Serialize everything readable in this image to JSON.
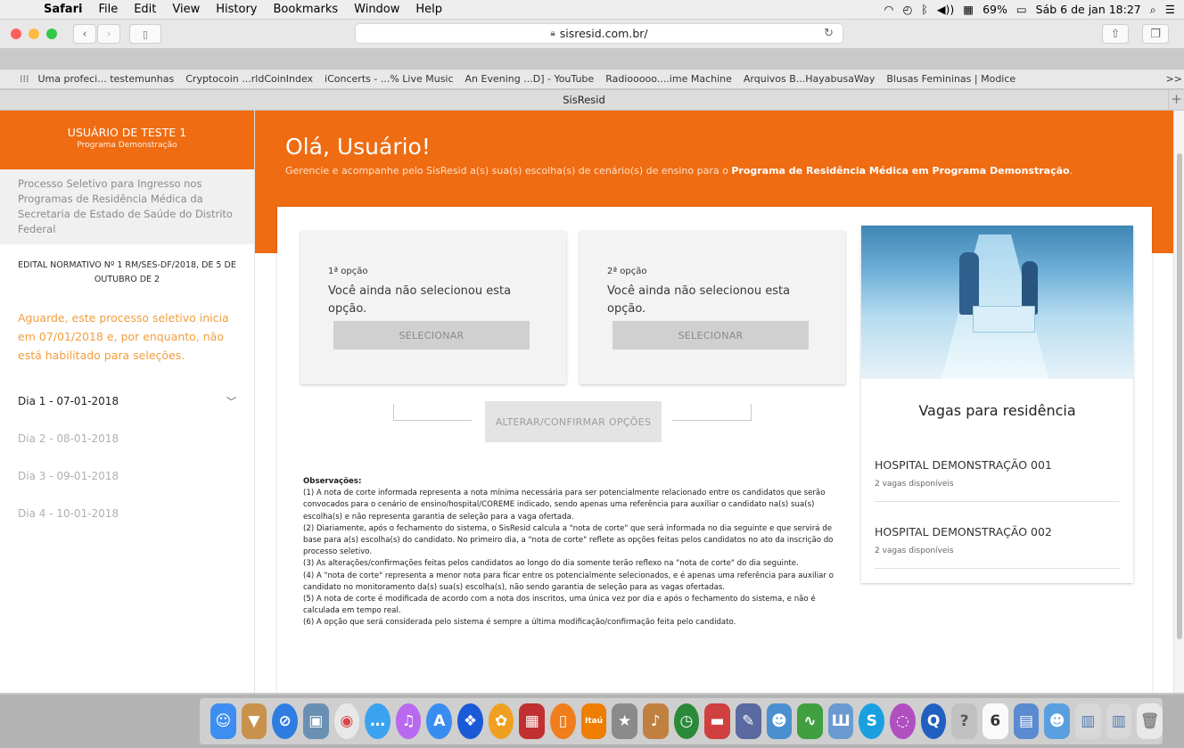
{
  "menubar": {
    "app": "Safari",
    "items": [
      "File",
      "Edit",
      "View",
      "History",
      "Bookmarks",
      "Window",
      "Help"
    ],
    "battery": "69%",
    "clock": "Sáb 6 de jan  18:27"
  },
  "toolbar": {
    "url": "sisresid.com.br/"
  },
  "bookmarks": {
    "items": [
      "Uma profeci... testemunhas",
      "Cryptocoin ...rldCoinIndex",
      "iConcerts - ...% Live Music",
      "An Evening ...D] - YouTube",
      "Radiooooo....ime Machine",
      "Arquivos B...HayabusaWay",
      "Blusas Femininas | Modice"
    ],
    "more": ">>"
  },
  "tab": {
    "title": "SisResid"
  },
  "sidebar": {
    "user": "USUÁRIO DE TESTE 1",
    "program": "Programa Demonstração",
    "process": "Processo Seletivo para Ingresso nos Programas de Residência Médica da Secretaria de Estado de Saúde do Distrito Federal",
    "edital": "EDITAL NORMATIVO Nº 1 RM/SES-DF/2018, DE 5 DE OUTUBRO DE 2",
    "wait": "Aguarde, este processo seletivo inicia em 07/01/2018 e, por enquanto, não está habilitado para seleções.",
    "days": [
      "Dia 1 - 07-01-2018",
      "Dia 2 - 08-01-2018",
      "Dia 3 - 09-01-2018",
      "Dia 4 - 10-01-2018"
    ]
  },
  "hero": {
    "greeting": "Olá, Usuário!",
    "subtitle": "Gerencie e acompanhe pelo SisResid a(s) sua(s) escolha(s) de cenário(s) de ensino para o ",
    "subtitle_bold": "Programa de Residência Médica em Programa Demonstração",
    "subtitle_end": "."
  },
  "options": [
    {
      "label": "1ª opção",
      "message": "Você ainda não selecionou esta opção.",
      "button": "SELECIONAR"
    },
    {
      "label": "2ª opção",
      "message": "Você ainda não selecionou esta opção.",
      "button": "SELECIONAR"
    }
  ],
  "alter_button": "ALTERAR/CONFIRMAR OPÇÕES",
  "observations": {
    "title": "Observações:",
    "items": [
      "(1) A nota de corte informada representa a nota mínima necessária para ser potencialmente relacionado entre os candidatos que serão convocados para o cenário de ensino/hospital/COREME indicado, sendo apenas uma referência para auxiliar o candidato na(s) sua(s) escolha(s) e não representa garantia de seleção para a vaga ofertada.",
      "(2) Diariamente, após o fechamento do sistema, o SisResid calcula a \"nota de corte\" que será informada no dia seguinte e que servirá de base para a(s) escolha(s) do candidato. No primeiro dia, a \"nota de corte\" reflete as opções feitas pelos candidatos no ato da inscrição do processo seletivo.",
      "(3) As alterações/confirmações feitas pelos candidatos ao longo do dia somente terão reflexo na \"nota de corte\" do dia seguinte.",
      "(4) A \"nota de corte\" representa a menor nota para ficar entre os potencialmente selecionados, e é apenas uma referência para auxiliar o candidato no monitoramento da(s) sua(s) escolha(s), não sendo garantia de seleção para as vagas ofertadas.",
      "(5) A nota de corte é modificada de acordo com a nota dos inscritos, uma única vez por dia e após o fechamento do sistema, e não é calculada em tempo real.",
      "(6) A opção que será considerada pelo sistema é sempre a última modificação/confirmação feita pelo candidato."
    ]
  },
  "vagas": {
    "title": "Vagas para residência",
    "hospitals": [
      {
        "name": "HOSPITAL DEMONSTRAÇÃO 001",
        "vacancies": "2 vagas disponíveis"
      },
      {
        "name": "HOSPITAL DEMONSTRAÇÃO 002",
        "vacancies": "2 vagas disponíveis"
      }
    ]
  },
  "colors": {
    "accent": "#ef6c12",
    "warning_text": "#f29d3d"
  }
}
